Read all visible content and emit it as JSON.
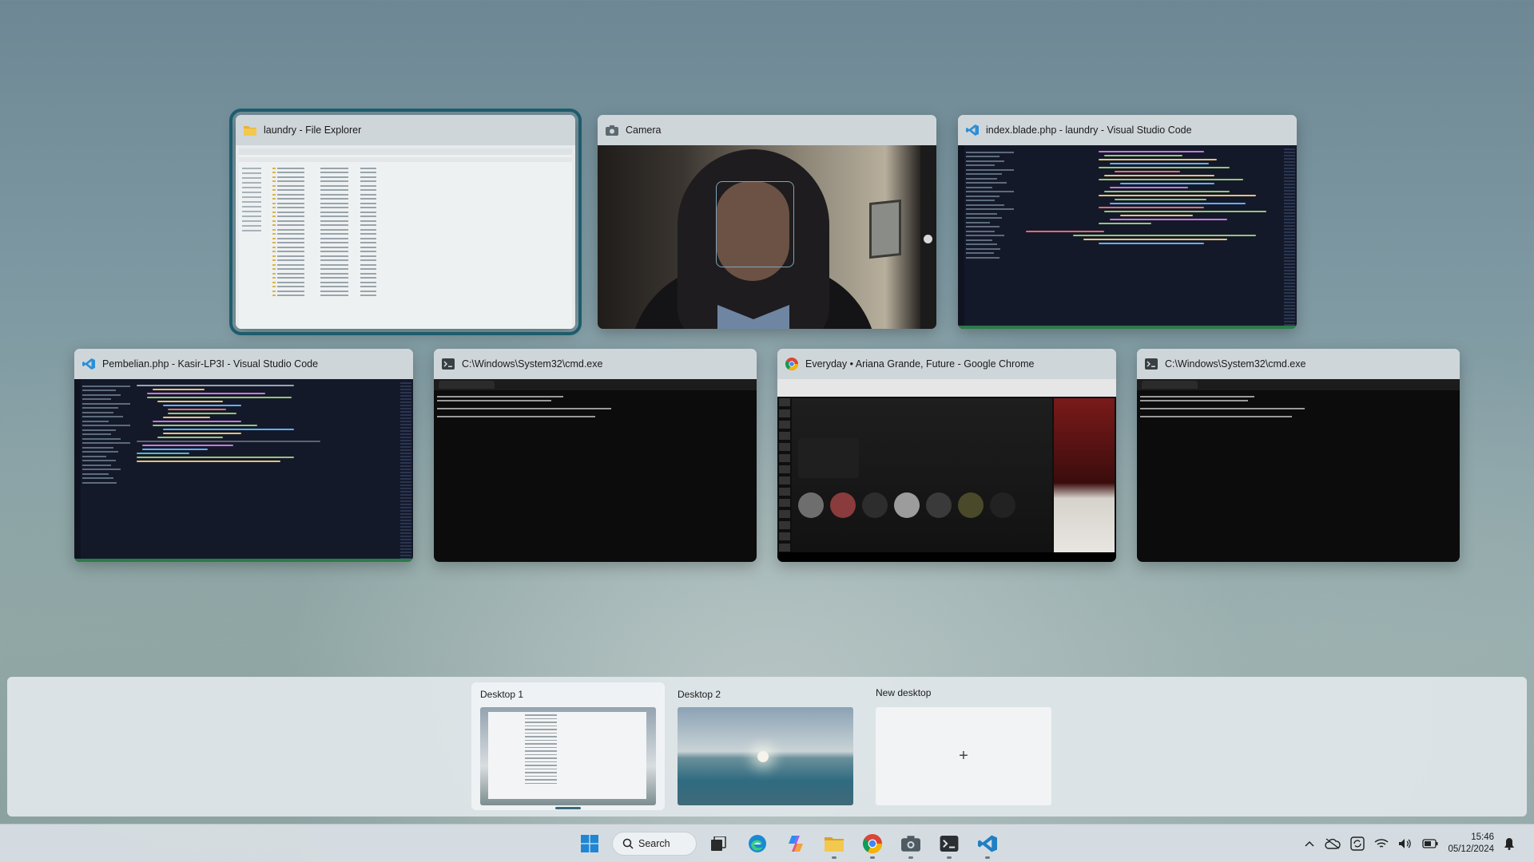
{
  "windows": {
    "explorer": {
      "title": "laundry - File Explorer",
      "icon": "folder-icon"
    },
    "camera": {
      "title": "Camera",
      "icon": "camera-icon"
    },
    "vscode_index": {
      "title": "index.blade.php - laundry - Visual Studio Code",
      "icon": "vscode-icon"
    },
    "vscode_pembelian": {
      "title": "Pembelian.php - Kasir-LP3I - Visual Studio Code",
      "icon": "vscode-icon"
    },
    "cmd1": {
      "title": "C:\\Windows\\System32\\cmd.exe",
      "icon": "terminal-icon"
    },
    "chrome": {
      "title": "Everyday • Ariana Grande, Future - Google Chrome",
      "icon": "chrome-icon"
    },
    "cmd2": {
      "title": "C:\\Windows\\System32\\cmd.exe",
      "icon": "terminal-icon"
    }
  },
  "desktops": {
    "desktop1": {
      "label": "Desktop 1"
    },
    "desktop2": {
      "label": "Desktop 2"
    },
    "new_desktop": {
      "label": "New desktop",
      "plus": "+"
    }
  },
  "taskbar": {
    "search_label": "Search",
    "time": "15:46",
    "date": "05/12/2024",
    "apps": [
      "start-icon",
      "search",
      "task-view-icon",
      "edge-icon",
      "copilot-icon",
      "file-explorer-icon",
      "chrome-icon",
      "camera-icon",
      "terminal-icon",
      "vscode-icon"
    ],
    "tray": [
      "chevron-up-icon",
      "onedrive-icon",
      "sync-icon",
      "wifi-icon",
      "volume-icon",
      "battery-icon",
      "notification-bell-icon"
    ]
  },
  "colors": {
    "selection_outline": "#1d5c6c",
    "vscode_blue": "#2b8fd6",
    "folder_yellow": "#e6b23a"
  }
}
